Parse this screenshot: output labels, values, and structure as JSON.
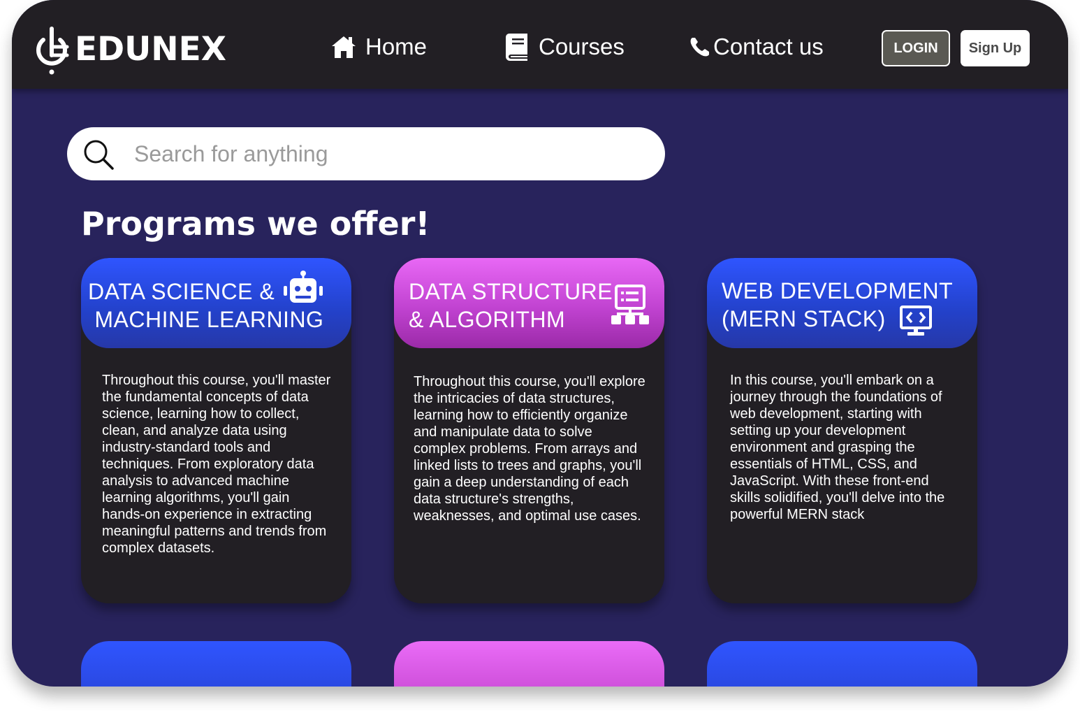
{
  "brand": {
    "name": "EDUNEX"
  },
  "nav": {
    "home": "Home",
    "courses": "Courses",
    "contact": "Contact us"
  },
  "auth": {
    "login": "LOGIN",
    "signup": "Sign Up"
  },
  "search": {
    "placeholder": "Search for anything",
    "value": ""
  },
  "programs": {
    "title": "Programs we offer!",
    "cards": [
      {
        "title": "DATA SCIENCE &\n MACHINE LEARNING",
        "icon": "robot-icon",
        "description": "Throughout this course, you'll master the fundamental concepts of data science, learning how to collect, clean, and analyze data using industry-standard tools and techniques. From exploratory data analysis to advanced machine learning algorithms, you'll gain hands-on experience in extracting meaningful patterns and trends from complex datasets."
      },
      {
        "title": "DATA STRUCTURE\n& ALGORITHM",
        "icon": "data-structure-icon",
        "description": "Throughout this course, you'll explore the intricacies of data structures, learning how to efficiently organize and manipulate data to solve complex problems. From arrays and linked lists to trees and graphs, you'll gain a deep understanding of each data structure's strengths, weaknesses, and optimal use cases."
      },
      {
        "title": "WEB DEVELOPMENT\n(MERN STACK)",
        "icon": "code-monitor-icon",
        "description": "In this course, you'll embark on a journey through the foundations of web development, starting with setting up your development environment and grasping the essentials of HTML, CSS, and JavaScript. With these front-end skills solidified, you'll delve into the powerful MERN stack"
      }
    ]
  },
  "colors": {
    "page_background": "#28235c",
    "navbar": "#221f24",
    "card_body": "#221f24",
    "blue_accent": "#2f55ff",
    "pink_accent": "#e868f5",
    "login_button": "#5a5953"
  }
}
